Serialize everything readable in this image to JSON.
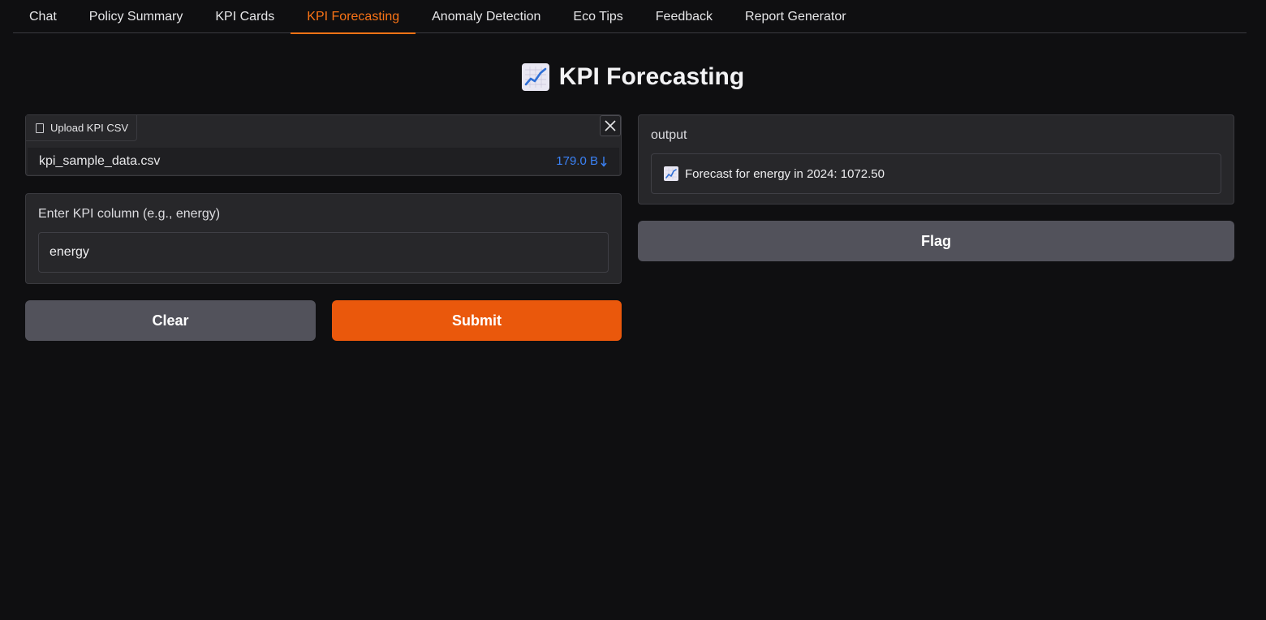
{
  "tabs": [
    {
      "label": "Chat",
      "active": false
    },
    {
      "label": "Policy Summary",
      "active": false
    },
    {
      "label": "KPI Cards",
      "active": false
    },
    {
      "label": "KPI Forecasting",
      "active": true
    },
    {
      "label": "Anomaly Detection",
      "active": false
    },
    {
      "label": "Eco Tips",
      "active": false
    },
    {
      "label": "Feedback",
      "active": false
    },
    {
      "label": "Report Generator",
      "active": false
    }
  ],
  "page": {
    "title": "KPI Forecasting",
    "title_icon": "chart-increasing-icon"
  },
  "upload": {
    "label": "Upload KPI CSV",
    "file_name": "kpi_sample_data.csv",
    "file_size": "179.0 B",
    "icons": {
      "file": "file-icon",
      "close": "close-icon",
      "download": "download-arrow-icon"
    }
  },
  "kpi_input": {
    "label": "Enter KPI column (e.g., energy)",
    "value": "energy"
  },
  "buttons": {
    "clear": "Clear",
    "submit": "Submit",
    "flag": "Flag"
  },
  "output": {
    "label": "output",
    "text": "Forecast for energy in 2024: 1072.50",
    "icon": "chart-increasing-icon"
  },
  "colors": {
    "accent": "#f97316",
    "submit": "#ea580c",
    "secondary_button": "#52525b",
    "link": "#3b82f6",
    "background": "#0f0f11",
    "panel": "#27272a"
  }
}
